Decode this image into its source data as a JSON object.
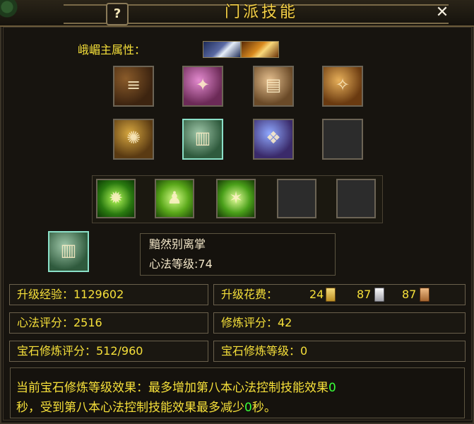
{
  "window": {
    "title": "门派技能",
    "help": "?",
    "close": "✕"
  },
  "attribute": {
    "label": "峨嵋主属性：",
    "icons": [
      "ice-attribute-icon",
      "fire-attribute-icon"
    ]
  },
  "book_slots": [
    {
      "name": "book-slot-1",
      "icon": "scroll-book-icon"
    },
    {
      "name": "book-slot-2",
      "icon": "pink-book-icon"
    },
    {
      "name": "book-slot-3",
      "icon": "tan-book-icon"
    },
    {
      "name": "book-slot-4",
      "icon": "orange-book-icon"
    },
    {
      "name": "book-slot-5",
      "icon": "gold-book-icon"
    },
    {
      "name": "book-slot-6",
      "icon": "green-book-icon"
    },
    {
      "name": "book-slot-7",
      "icon": "purple-book-icon"
    },
    {
      "name": "book-slot-8",
      "icon": "empty-slot"
    }
  ],
  "skills": [
    {
      "name": "skill-slot-1",
      "icon": "green-leaf-skill-icon"
    },
    {
      "name": "skill-slot-2",
      "icon": "green-figure-skill-icon"
    },
    {
      "name": "skill-slot-3",
      "icon": "green-burst-skill-icon"
    },
    {
      "name": "skill-slot-4",
      "icon": "empty-slot"
    },
    {
      "name": "skill-slot-5",
      "icon": "empty-slot"
    }
  ],
  "selected": {
    "icon": "green-book-icon",
    "name": "黯然别离掌",
    "level_label": "心法等级",
    "level": "74",
    "level_text": "心法等级:74"
  },
  "stats": {
    "upgrade_exp": "升级经验：1129602",
    "upgrade_cost_label": "升级花费：",
    "cost": [
      {
        "amount": "24",
        "icon": "gold-ingot-icon"
      },
      {
        "amount": "87",
        "icon": "silver-ingot-icon"
      },
      {
        "amount": "87",
        "icon": "copper-ingot-icon"
      }
    ],
    "xinfa_score": "心法评分：2516",
    "xiulian_score": "修炼评分：42",
    "gem_score": "宝石修炼评分：512/960",
    "gem_level": "宝石修炼等级：0"
  },
  "effect": {
    "line1_prefix": "当前宝石修炼等级效果：最多增加第八本心法控制技能效果",
    "line1_value": "0",
    "line2_prefix": "秒，受到第八本心法控制技能效果最多减少",
    "line2_value": "0",
    "line2_suffix": "秒。"
  },
  "colors": {
    "accent_text": "#f6e03a",
    "title_text": "#f6d24a",
    "value_highlight": "#39ff39",
    "panel_bg": "#17140f"
  }
}
